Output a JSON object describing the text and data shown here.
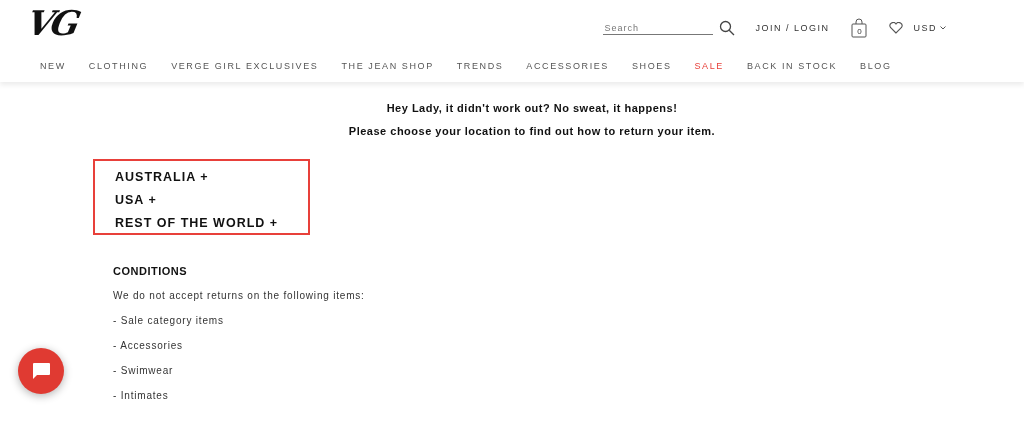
{
  "header": {
    "logo": "VG",
    "search": {
      "placeholder": "Search"
    },
    "account_link": "JOIN / LOGIN",
    "cart_count": "0",
    "currency": "USD"
  },
  "nav": [
    {
      "label": "NEW",
      "highlighted": false
    },
    {
      "label": "CLOTHING",
      "highlighted": false
    },
    {
      "label": "VERGE GIRL EXCLUSIVES",
      "highlighted": false
    },
    {
      "label": "THE JEAN SHOP",
      "highlighted": false
    },
    {
      "label": "TRENDS",
      "highlighted": false
    },
    {
      "label": "ACCESSORIES",
      "highlighted": false
    },
    {
      "label": "SHOES",
      "highlighted": false
    },
    {
      "label": "SALE",
      "highlighted": true
    },
    {
      "label": "BACK IN STOCK",
      "highlighted": false
    },
    {
      "label": "BLOG",
      "highlighted": false
    }
  ],
  "intro": [
    "Hey Lady, it didn't work out? No sweat, it happens!",
    "Please choose your location to find out how to return your item."
  ],
  "locations": {
    "highlighted": true,
    "items": [
      {
        "label": "AUSTRALIA +",
        "expanded": false
      },
      {
        "label": "USA +",
        "expanded": false
      },
      {
        "label": "REST OF THE WORLD +",
        "expanded": false
      }
    ]
  },
  "conditions": {
    "title": "CONDITIONS",
    "text": "We do not accept returns on the following items:",
    "items": [
      "- Sale category items",
      "- Accessories",
      "- Swimwear",
      "- Intimates"
    ]
  }
}
